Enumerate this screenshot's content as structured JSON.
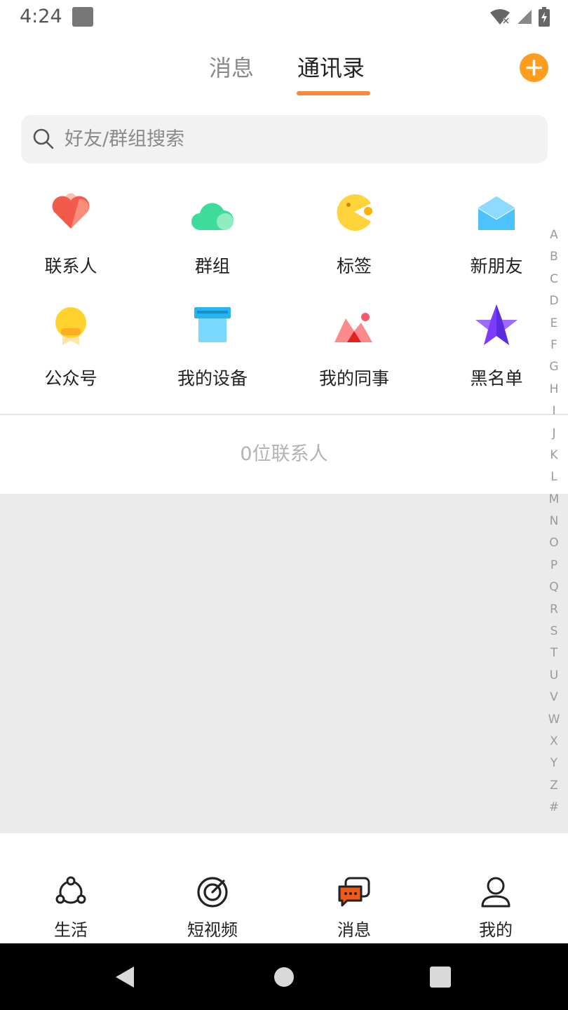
{
  "status_bar": {
    "time": "4:24"
  },
  "header": {
    "tabs": [
      {
        "label": "消息",
        "active": false
      },
      {
        "label": "通讯录",
        "active": true
      }
    ],
    "accent_color": "#f38a3d",
    "add_icon": "plus-circle-icon"
  },
  "search": {
    "placeholder": "好友/群组搜索",
    "value": ""
  },
  "features": [
    {
      "label": "联系人",
      "icon": "heart-icon"
    },
    {
      "label": "群组",
      "icon": "cloud-icon"
    },
    {
      "label": "标签",
      "icon": "pacman-icon"
    },
    {
      "label": "新朋友",
      "icon": "envelope-icon"
    },
    {
      "label": "公众号",
      "icon": "bulb-badge-icon"
    },
    {
      "label": "我的设备",
      "icon": "box-icon"
    },
    {
      "label": "我的同事",
      "icon": "mountain-icon"
    },
    {
      "label": "黑名单",
      "icon": "star-icon"
    }
  ],
  "contacts_summary": "0位联系人",
  "alphabet_index": [
    "A",
    "B",
    "C",
    "D",
    "E",
    "F",
    "G",
    "H",
    "I",
    "J",
    "K",
    "L",
    "M",
    "N",
    "O",
    "P",
    "Q",
    "R",
    "S",
    "T",
    "U",
    "V",
    "W",
    "X",
    "Y",
    "Z",
    "#"
  ],
  "bottom_nav": [
    {
      "label": "生活",
      "icon": "life-icon"
    },
    {
      "label": "短视频",
      "icon": "target-icon"
    },
    {
      "label": "消息",
      "icon": "chat-icon"
    },
    {
      "label": "我的",
      "icon": "person-icon"
    }
  ]
}
